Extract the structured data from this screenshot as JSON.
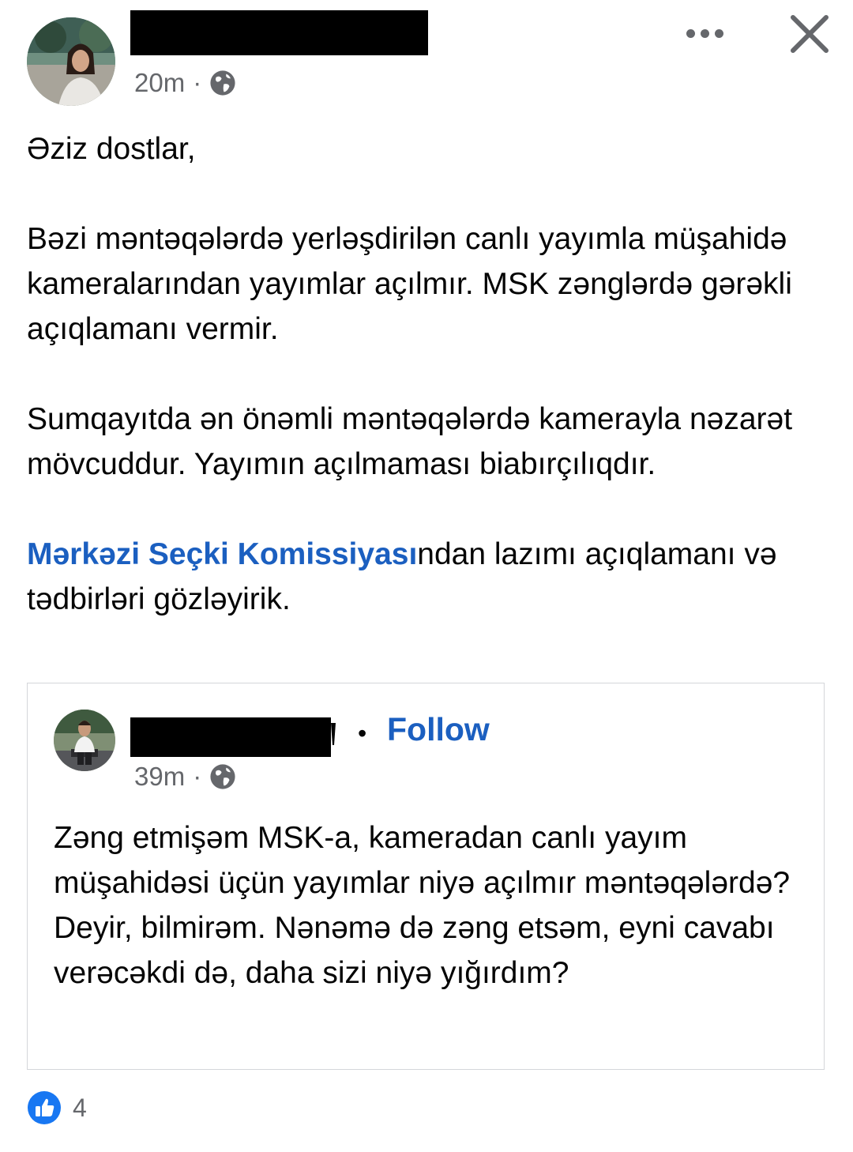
{
  "post": {
    "author_avatar": "profile-photo",
    "time": "20m",
    "separator": "·",
    "audience_icon": "globe-icon",
    "menu_icon": "more-horizontal-icon",
    "close_icon": "close-icon",
    "paragraphs": {
      "p1": "Əziz dostlar,",
      "p2": "Bəzi məntəqələrdə yerləşdirilən canlı yayımla müşahidə kameralarından yayımlar açılmır. MSK zənglərdə gərəkli açıqlamanı vermir.",
      "p3": "Sumqayıtda ən önəmli məntəqələrdə kamerayla nəzarət mövcuddur. Yayımın açılmaması biabırçılıqdır.",
      "p4_link": "Mərkəzi Seçki Komissiyası",
      "p4_rest": "ndan lazımı açıqlamanı və tədbirləri gözləyirik."
    }
  },
  "shared_post": {
    "author_avatar": "profile-photo",
    "dot": "•",
    "follow_label": "Follow",
    "time": "39m",
    "separator": "·",
    "audience_icon": "globe-icon",
    "text": "Zəng etmişəm MSK-a, kameradan canlı yayım müşahidəsi üçün yayımlar niyə açılmır məntəqələrdə? Deyir, bilmirəm. Nənəmə də zəng etsəm, eyni cavabı verəcəkdi də, daha sizi niyə yığırdım?"
  },
  "reactions": {
    "icon": "like-icon",
    "count": "4"
  },
  "colors": {
    "link": "#1b5fc0",
    "secondary_text": "#65676b",
    "like_blue": "#1877f2"
  }
}
